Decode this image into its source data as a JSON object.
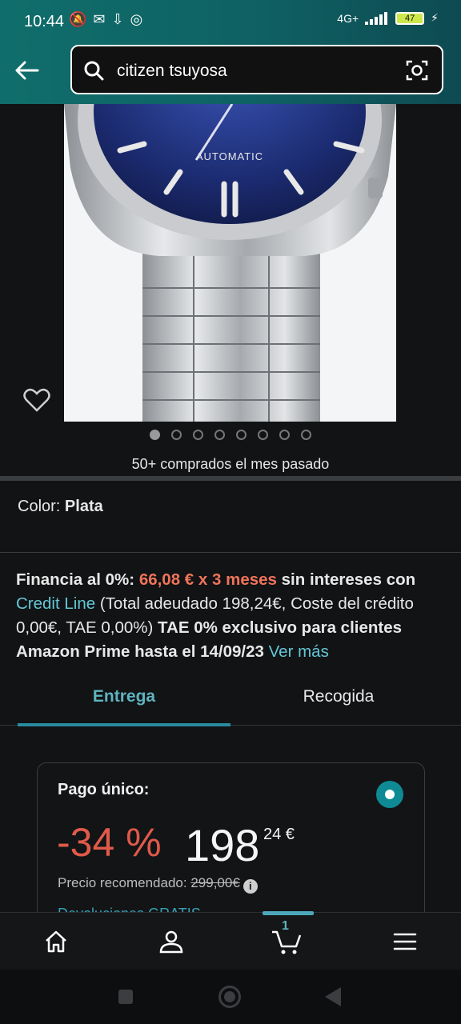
{
  "status_bar": {
    "time": "10:44",
    "network": "4G+",
    "battery": "47"
  },
  "search": {
    "query": "citizen tsuyosa"
  },
  "gallery": {
    "image_count": 8,
    "active_index": 0,
    "bought_text": "50+ comprados el mes pasado"
  },
  "color": {
    "label": "Color:",
    "value": "Plata"
  },
  "financing": {
    "prefix": "Financia al 0%:",
    "installment": "66,08 € x 3 meses",
    "no_interest": "sin intereses",
    "con": "con",
    "credit_line": "Credit Line",
    "total_text": "(Total adeudado 198,24€, Coste del crédito 0,00€, TAE 0,00%)",
    "prime_text": "TAE 0% exclusivo para clientes Amazon Prime hasta el 14/09/23",
    "more_link": "Ver más"
  },
  "tabs": [
    {
      "label": "Entrega",
      "active": true
    },
    {
      "label": "Recogida",
      "active": false
    }
  ],
  "price_card": {
    "title": "Pago único:",
    "discount": "-34 %",
    "price_whole": "198",
    "price_fraction": "24 €",
    "recommended_label": "Precio recomendado:",
    "recommended_price": "299,00€",
    "returns_text": "Devoluciones GRATIS"
  },
  "bottom_nav": {
    "cart_count": "1"
  },
  "colors": {
    "accent": "#5fb3c0",
    "header": "#0f6e6b",
    "discount": "#e05a4a"
  }
}
